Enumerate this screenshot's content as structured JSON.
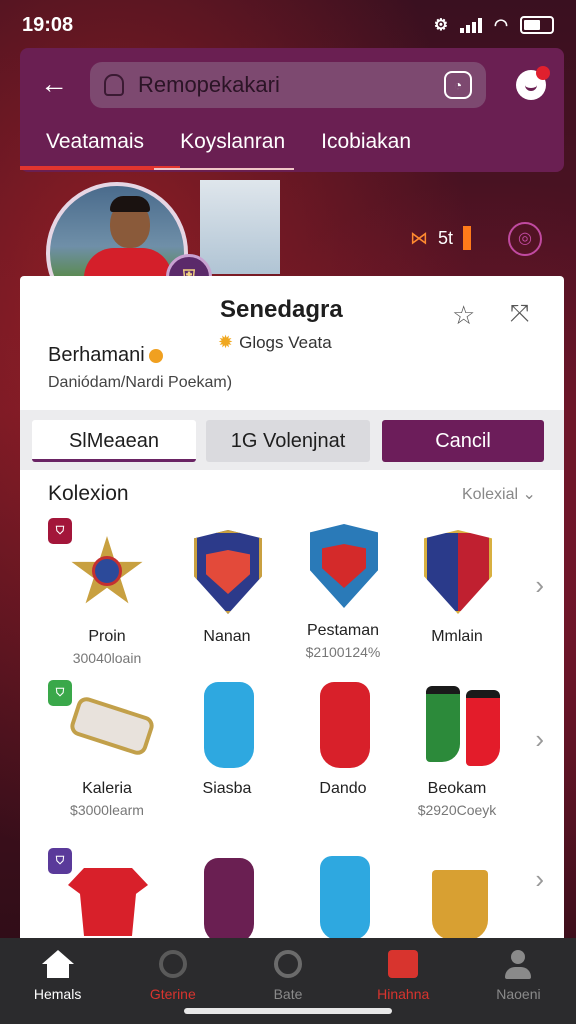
{
  "status_bar": {
    "time": "19:08"
  },
  "header": {
    "search_placeholder": "Remopekakari",
    "tabs": [
      "Veatamais",
      "Koyslanran",
      "Icobiakan"
    ]
  },
  "hero": {
    "stat_text": "5t"
  },
  "profile": {
    "card_name": "Senedagra",
    "card_sub": "Glogs Veata",
    "name": "Berhamani",
    "team": "Daniódam/Nardi Poekam)"
  },
  "segment": {
    "options": [
      "SlMeaean",
      "1G Volenjnat",
      "Cancil"
    ]
  },
  "collection": {
    "title": "Kolexion",
    "filter": "Kolexial",
    "rows": [
      {
        "items": [
          {
            "label": "Proin",
            "price": "30040loain"
          },
          {
            "label": "Nanan",
            "price": ""
          },
          {
            "label": "Pestaman",
            "price": "$2100124%"
          },
          {
            "label": "Mmlain",
            "price": ""
          }
        ]
      },
      {
        "items": [
          {
            "label": "Kaleria",
            "price": "$3000learm"
          },
          {
            "label": "Siasba",
            "price": ""
          },
          {
            "label": "Dando",
            "price": ""
          },
          {
            "label": "Beokam",
            "price": "$2920Coeyk"
          }
        ]
      },
      {
        "items": [
          {
            "label": "",
            "price": ""
          },
          {
            "label": "",
            "price": ""
          },
          {
            "label": "",
            "price": ""
          },
          {
            "label": "",
            "price": ""
          }
        ]
      }
    ]
  },
  "bottom_nav": [
    "Hemals",
    "Gterine",
    "Bate",
    "Hinahna",
    "Naoeni"
  ],
  "colors": {
    "primary": "#6a1f52",
    "accent": "#e2352f",
    "nav_bg": "#2b2b2d"
  }
}
